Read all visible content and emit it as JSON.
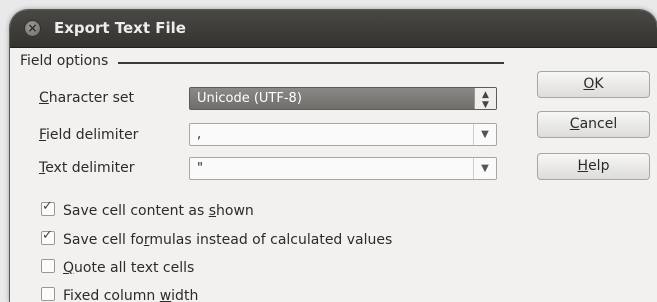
{
  "window": {
    "title": "Export Text File",
    "close_icon": "close-icon"
  },
  "field_options": {
    "label": "Field options",
    "character_set": {
      "mnemonic": "C",
      "rest": "haracter set",
      "value": "Unicode (UTF-8)"
    },
    "field_delimiter": {
      "mnemonic": "F",
      "rest": "ield delimiter",
      "value": ","
    },
    "text_delimiter": {
      "mnemonic": "T",
      "rest": "ext delimiter",
      "value": "\""
    }
  },
  "checkboxes": [
    {
      "before": "Save cell content as ",
      "mnemonic": "s",
      "after": "hown",
      "checked": true
    },
    {
      "before": "Save cell fo",
      "mnemonic": "r",
      "after": "mulas instead of calculated values",
      "checked": true
    },
    {
      "before": "",
      "mnemonic": "Q",
      "after": "uote all text cells",
      "checked": false
    },
    {
      "before": "Fixed column ",
      "mnemonic": "w",
      "after": "idth",
      "checked": false
    }
  ],
  "buttons": {
    "ok": {
      "before": "",
      "mnemonic": "O",
      "after": "K"
    },
    "cancel": {
      "before": "",
      "mnemonic": "C",
      "after": "ancel"
    },
    "help": {
      "before": "",
      "mnemonic": "H",
      "after": "elp"
    }
  },
  "colors": {
    "titlebar": "#3c3b37",
    "selected_combo": "#7d7c78",
    "dialog_bg": "#f2f1ef"
  }
}
